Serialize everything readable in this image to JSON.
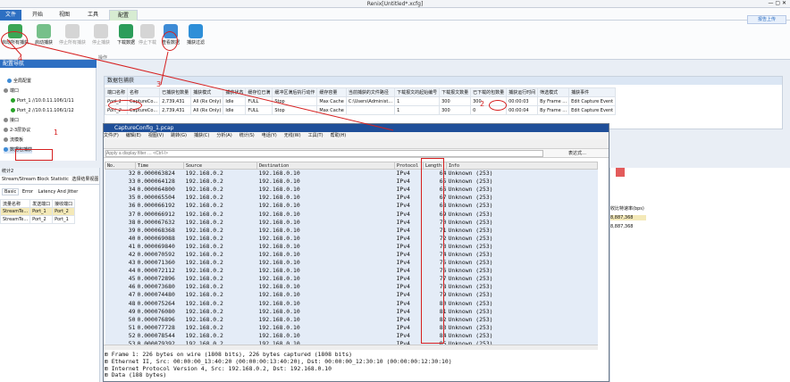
{
  "window": {
    "title": "Renix[Untitled*.xcfg]",
    "context_tab": "工具"
  },
  "menu_tabs": [
    {
      "label": "文件"
    },
    {
      "label": "开始"
    },
    {
      "label": "视图"
    },
    {
      "label": "工具"
    },
    {
      "label": "配置"
    }
  ],
  "ribbon": {
    "buttons": [
      {
        "label": "启动所有捕获"
      },
      {
        "label": "启动捕获"
      },
      {
        "label": "停止所有捕获"
      },
      {
        "label": "停止捕获"
      },
      {
        "label": "下载数据"
      },
      {
        "label": "停止下载"
      },
      {
        "label": "查看数据"
      },
      {
        "label": "捕获过滤"
      }
    ],
    "group_label": "操作",
    "right_button": "报告上传"
  },
  "nav": {
    "title": "配置导航",
    "items": [
      {
        "label": "全局配置"
      },
      {
        "label": "端口"
      },
      {
        "label": "Port_1 //10.0.11.106/1/11"
      },
      {
        "label": "Port_2 //10.0.11.106/1/12"
      },
      {
        "label": "接口"
      },
      {
        "label": "2-3层协议"
      },
      {
        "label": "流模板"
      },
      {
        "label": "数据包捕获"
      }
    ]
  },
  "capture_grid": {
    "title": "数据包捕获",
    "headers": [
      "端口名称",
      "名称",
      "已捕获包数量",
      "捕获模式",
      "捕获状态",
      "缓存位已满",
      "缓冲区满后执行动作",
      "缓存容量",
      "当前捕获的文件路径",
      "下载报文的起始编号",
      "下载报文数量",
      "已下载的包数量",
      "捕获运行时间",
      "筛选模式",
      "捕获事件"
    ],
    "rows": [
      [
        "Port_1",
        "CaptureCo...",
        "2,739,431",
        "All (Rx Only)",
        "Idle",
        "FULL",
        "Stop",
        "Max Cache",
        "C:\\Users\\Administ...",
        "1",
        "300",
        "300",
        "00:00:03",
        "By Frame ...",
        "Edit Capture Event"
      ],
      [
        "Port_2",
        "CaptureCo...",
        "2,739,431",
        "All (Rx Only)",
        "Idle",
        "FULL",
        "Stop",
        "Max Cache",
        "",
        "1",
        "300",
        "0",
        "00:00:04",
        "By Frame ...",
        "Edit Capture Event"
      ]
    ]
  },
  "wireshark": {
    "title": "CaptureConfig_1.pcap",
    "menu": [
      "文件(F)",
      "编辑(E)",
      "视图(V)",
      "跳转(G)",
      "捕获(C)",
      "分析(A)",
      "统计(S)",
      "电话(Y)",
      "无线(W)",
      "工具(T)",
      "帮助(H)"
    ],
    "filter_placeholder": "Apply a display filter … <Ctrl-/>",
    "filter_expr": "表达式…",
    "columns": [
      "No.",
      "Time",
      "Source",
      "Destination",
      "Protocol",
      "Length",
      "Info"
    ],
    "packets": [
      [
        "32",
        "0.000063824",
        "192.168.0.2",
        "192.168.0.10",
        "IPv4",
        "64",
        "Unknown (253)"
      ],
      [
        "33",
        "0.000064128",
        "192.168.0.2",
        "192.168.0.10",
        "IPv4",
        "65",
        "Unknown (253)"
      ],
      [
        "34",
        "0.000064800",
        "192.168.0.2",
        "192.168.0.10",
        "IPv4",
        "66",
        "Unknown (253)"
      ],
      [
        "35",
        "0.000065504",
        "192.168.0.2",
        "192.168.0.10",
        "IPv4",
        "67",
        "Unknown (253)"
      ],
      [
        "36",
        "0.000066192",
        "192.168.0.2",
        "192.168.0.10",
        "IPv4",
        "68",
        "Unknown (253)"
      ],
      [
        "37",
        "0.000066912",
        "192.168.0.2",
        "192.168.0.10",
        "IPv4",
        "69",
        "Unknown (253)"
      ],
      [
        "38",
        "0.000067632",
        "192.168.0.2",
        "192.168.0.10",
        "IPv4",
        "70",
        "Unknown (253)"
      ],
      [
        "39",
        "0.000068368",
        "192.168.0.2",
        "192.168.0.10",
        "IPv4",
        "71",
        "Unknown (253)"
      ],
      [
        "40",
        "0.000069088",
        "192.168.0.2",
        "192.168.0.10",
        "IPv4",
        "72",
        "Unknown (253)"
      ],
      [
        "41",
        "0.000069840",
        "192.168.0.2",
        "192.168.0.10",
        "IPv4",
        "73",
        "Unknown (253)"
      ],
      [
        "42",
        "0.000070592",
        "192.168.0.2",
        "192.168.0.10",
        "IPv4",
        "74",
        "Unknown (253)"
      ],
      [
        "43",
        "0.000071360",
        "192.168.0.2",
        "192.168.0.10",
        "IPv4",
        "75",
        "Unknown (253)"
      ],
      [
        "44",
        "0.000072112",
        "192.168.0.2",
        "192.168.0.10",
        "IPv4",
        "76",
        "Unknown (253)"
      ],
      [
        "45",
        "0.000072896",
        "192.168.0.2",
        "192.168.0.10",
        "IPv4",
        "77",
        "Unknown (253)"
      ],
      [
        "46",
        "0.000073680",
        "192.168.0.2",
        "192.168.0.10",
        "IPv4",
        "78",
        "Unknown (253)"
      ],
      [
        "47",
        "0.000074480",
        "192.168.0.2",
        "192.168.0.10",
        "IPv4",
        "79",
        "Unknown (253)"
      ],
      [
        "48",
        "0.000075264",
        "192.168.0.2",
        "192.168.0.10",
        "IPv4",
        "80",
        "Unknown (253)"
      ],
      [
        "49",
        "0.000076080",
        "192.168.0.2",
        "192.168.0.10",
        "IPv4",
        "81",
        "Unknown (253)"
      ],
      [
        "50",
        "0.000076896",
        "192.168.0.2",
        "192.168.0.10",
        "IPv4",
        "82",
        "Unknown (253)"
      ],
      [
        "51",
        "0.000077728",
        "192.168.0.2",
        "192.168.0.10",
        "IPv4",
        "83",
        "Unknown (253)"
      ],
      [
        "52",
        "0.000078544",
        "192.168.0.2",
        "192.168.0.10",
        "IPv4",
        "84",
        "Unknown (253)"
      ],
      [
        "53",
        "0.000079392",
        "192.168.0.2",
        "192.168.0.10",
        "IPv4",
        "85",
        "Unknown (253)"
      ]
    ],
    "details": [
      "Frame 1: 226 bytes on wire (1808 bits), 226 bytes captured (1808 bits)",
      "Ethernet II, Src: 00:00:00_13:40:20 (00:00:00:13:40:20), Dst: 00:00:00_12:30:10 (00:00:00:12:30:10)",
      "Internet Protocol Version 4, Src: 192.168.0.2, Dst: 192.168.0.10",
      "Data (188 bytes)"
    ]
  },
  "stats_panel": {
    "title": "统计2",
    "tabs_row": [
      "Stream/Stream Block Statistic",
      "选择结果视图"
    ],
    "sub_tabs": [
      "Basic",
      "Error",
      "Latency And Jitter"
    ],
    "headers": [
      "流量名称",
      "发送端口",
      "接收端口"
    ],
    "rows": [
      [
        "StreamTe...",
        "Port_1",
        "Port_2"
      ],
      [
        "StreamTe...",
        "Port_2",
        "Port_1"
      ]
    ],
    "right_header": "收比特速率(bps)",
    "right_values": [
      "8,887,368",
      "8,887,368"
    ]
  },
  "annotations": [
    "1",
    "2",
    "3",
    "4"
  ]
}
